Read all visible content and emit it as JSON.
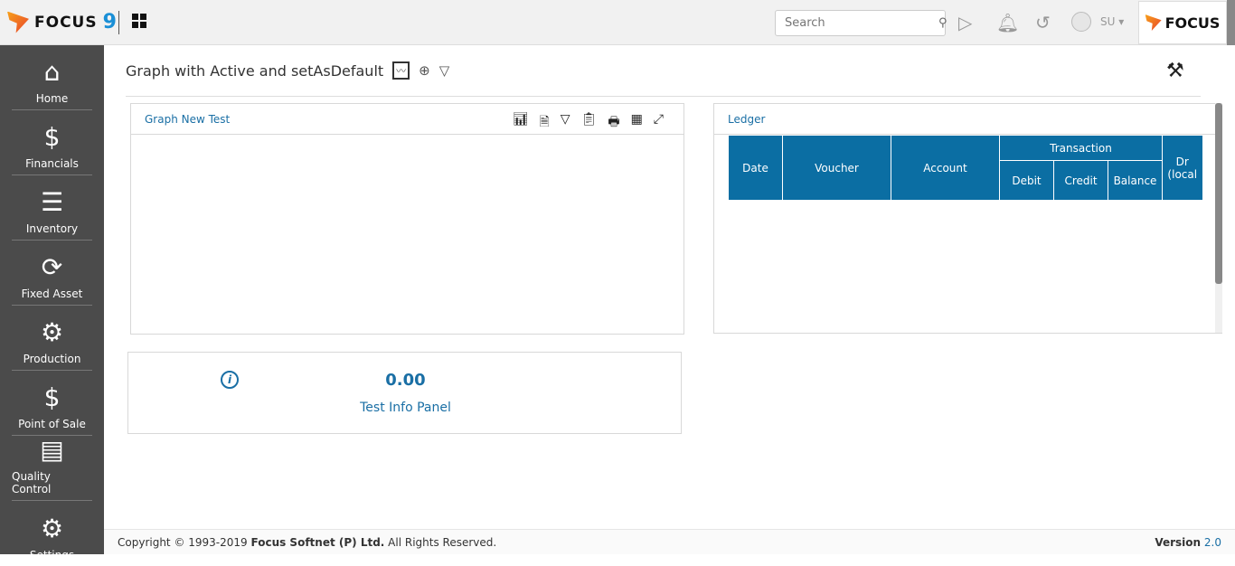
{
  "header": {
    "logo_text": "FOCUS",
    "logo_number": "9",
    "search_placeholder": "Search",
    "user": "SU",
    "brand_text": "FOCUS"
  },
  "sidebar": {
    "items": [
      {
        "label": "Home",
        "icon": "⌂"
      },
      {
        "label": "Financials",
        "icon": "$"
      },
      {
        "label": "Inventory",
        "icon": "☰"
      },
      {
        "label": "Fixed Asset",
        "icon": "⟳"
      },
      {
        "label": "Production",
        "icon": "⚙"
      },
      {
        "label": "Point of Sale",
        "icon": "$"
      },
      {
        "label": "Quality Control",
        "icon": "▤"
      },
      {
        "label": "Settings",
        "icon": "⚙"
      }
    ]
  },
  "page": {
    "title": "Graph with Active and setAsDefault"
  },
  "graph_panel": {
    "title": "Graph New Test"
  },
  "ledger": {
    "title": "Ledger",
    "columns": [
      "Date",
      "Voucher",
      "Account"
    ],
    "group": "Transaction",
    "sub_columns": [
      "Debit",
      "Credit",
      "Balance"
    ],
    "partial_column": "Dr (local"
  },
  "info_panel": {
    "value": "0.00",
    "label": "Test Info Panel"
  },
  "footer": {
    "copyright_prefix": "Copyright © 1993-2019",
    "company": "Focus Softnet (P) Ltd.",
    "rights": "All Rights Reserved.",
    "version_label": "Version",
    "version": "2.0"
  }
}
